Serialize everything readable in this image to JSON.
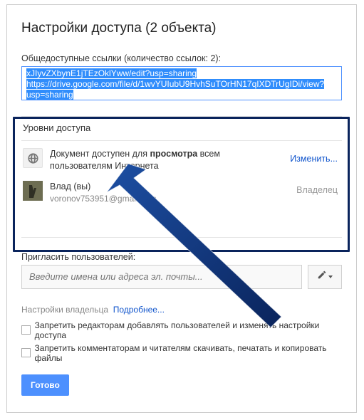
{
  "title": "Настройки доступа (2 объекта)",
  "public_links": {
    "label": "Общедоступные ссылки (количество ссылок: 2):",
    "url_line1": "xJIyvZXbynE1jTEzOklYww/edit?usp=sharing",
    "url_line2": "https://drive.google.com/file/d/1wvYUIubU9HvhSuTOrHN17qIXDTrUgIDi/view?",
    "url_line3": "usp=sharing"
  },
  "access_levels": {
    "heading": "Уровни доступа",
    "public_row": {
      "text_before": "Документ доступен для ",
      "text_bold": "просмотра",
      "text_after": " всем пользователям Интернета",
      "action": "Изменить..."
    },
    "owner_row": {
      "name": "Влад (вы)",
      "email": "voronov753951@gmail.com",
      "role": "Владелец"
    }
  },
  "invite": {
    "label": "Пригласить пользователей:",
    "placeholder": "Введите имена или адреса эл. почты..."
  },
  "owner_settings": {
    "label": "Настройки владельца",
    "more": "Подробнее...",
    "chk1": "Запретить редакторам добавлять пользователей и изменять настройки доступа",
    "chk2": "Запретить комментаторам и читателям скачивать, печатать и копировать файлы"
  },
  "done": "Готово"
}
